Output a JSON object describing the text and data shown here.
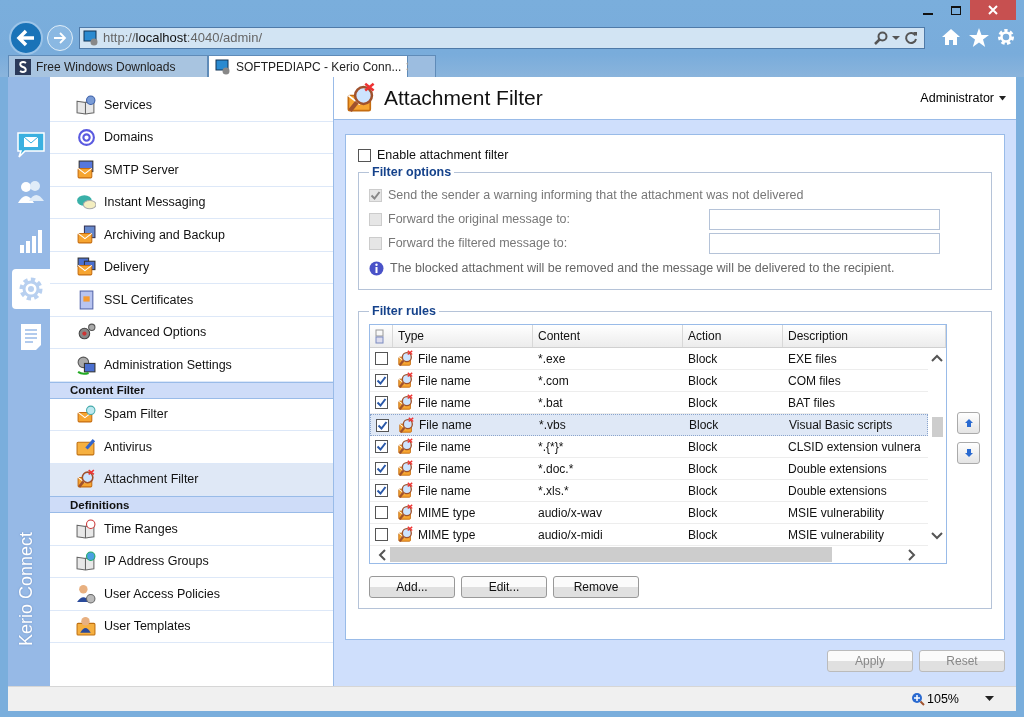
{
  "browser": {
    "url": "http://**localhost**:4040/admin/",
    "tabs": [
      {
        "label": "Free Windows Downloads",
        "selected": false
      },
      {
        "label": "SOFTPEDIAPC - Kerio Conn...",
        "selected": true
      }
    ]
  },
  "rail": {
    "items": [
      {
        "selected": false
      },
      {
        "selected": false
      },
      {
        "selected": false
      },
      {
        "selected": true
      },
      {
        "selected": false
      }
    ],
    "brand": "Kerio Connect"
  },
  "nav": {
    "sections": [
      {
        "items": [
          {
            "label": "Services",
            "selected": false
          },
          {
            "label": "Domains",
            "selected": false
          },
          {
            "label": "SMTP Server",
            "selected": false
          },
          {
            "label": "Instant Messaging",
            "selected": false
          },
          {
            "label": "Archiving and Backup",
            "selected": false
          },
          {
            "label": "Delivery",
            "selected": false
          },
          {
            "label": "SSL Certificates",
            "selected": false
          },
          {
            "label": "Advanced Options",
            "selected": false
          },
          {
            "label": "Administration Settings",
            "selected": false
          }
        ]
      },
      {
        "heading": "Content Filter",
        "items": [
          {
            "label": "Spam Filter",
            "selected": false
          },
          {
            "label": "Antivirus",
            "selected": false
          },
          {
            "label": "Attachment Filter",
            "selected": true
          }
        ]
      },
      {
        "heading": "Definitions",
        "items": [
          {
            "label": "Time Ranges",
            "selected": false
          },
          {
            "label": "IP Address Groups",
            "selected": false
          },
          {
            "label": "User Access Policies",
            "selected": false
          },
          {
            "label": "User Templates",
            "selected": false
          }
        ]
      }
    ]
  },
  "page": {
    "title": "Attachment Filter",
    "user": "Administrator"
  },
  "enable": {
    "label": "Enable attachment filter",
    "checked": false
  },
  "filter_options": {
    "legend": "Filter options",
    "options": [
      {
        "kind": "checkbox",
        "label": "Send the sender a warning informing that the attachment was not delivered",
        "checked": true,
        "disabled": true
      },
      {
        "kind": "field",
        "label": "Forward the original message to:",
        "checked": false,
        "disabled": true
      },
      {
        "kind": "field",
        "label": "Forward the filtered message to:",
        "checked": false,
        "disabled": true
      }
    ],
    "info": "The blocked attachment will be removed and the message will be delivered to the recipient."
  },
  "filter_rules": {
    "legend": "Filter rules",
    "columns": [
      "Type",
      "Content",
      "Action",
      "Description"
    ],
    "rows": [
      {
        "checked": false,
        "selected": false,
        "type": "File name",
        "content": "*.exe",
        "action": "Block",
        "description": "EXE files"
      },
      {
        "checked": true,
        "selected": false,
        "type": "File name",
        "content": "*.com",
        "action": "Block",
        "description": "COM files"
      },
      {
        "checked": true,
        "selected": false,
        "type": "File name",
        "content": "*.bat",
        "action": "Block",
        "description": "BAT files"
      },
      {
        "checked": true,
        "selected": true,
        "type": "File name",
        "content": "*.vbs",
        "action": "Block",
        "description": "Visual Basic scripts"
      },
      {
        "checked": true,
        "selected": false,
        "type": "File name",
        "content": "*.{*}*",
        "action": "Block",
        "description": "CLSID extension vulnera"
      },
      {
        "checked": true,
        "selected": false,
        "type": "File name",
        "content": "*.doc.*",
        "action": "Block",
        "description": "Double extensions"
      },
      {
        "checked": true,
        "selected": false,
        "type": "File name",
        "content": "*.xls.*",
        "action": "Block",
        "description": "Double extensions"
      },
      {
        "checked": false,
        "selected": false,
        "type": "MIME type",
        "content": "audio/x-wav",
        "action": "Block",
        "description": "MSIE vulnerability"
      },
      {
        "checked": false,
        "selected": false,
        "type": "MIME type",
        "content": "audio/x-midi",
        "action": "Block",
        "description": "MSIE vulnerability"
      }
    ],
    "buttons": [
      "Add...",
      "Edit...",
      "Remove"
    ]
  },
  "footer": {
    "buttons": [
      {
        "label": "Apply",
        "disabled": true
      },
      {
        "label": "Reset",
        "disabled": true
      }
    ]
  },
  "status": {
    "zoom": "105%"
  }
}
